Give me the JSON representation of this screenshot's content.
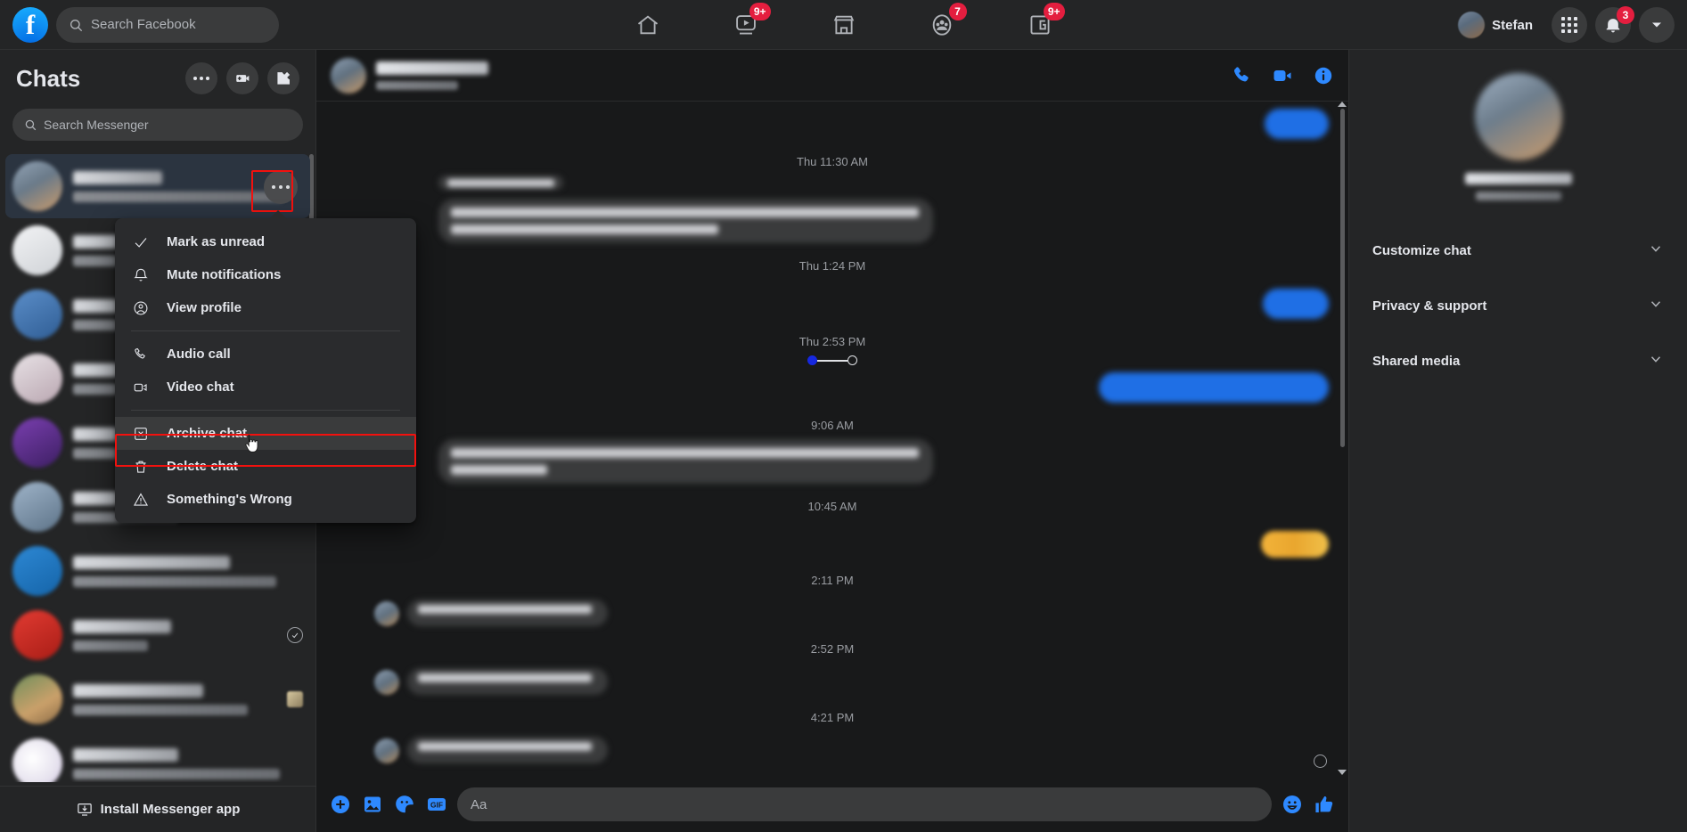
{
  "topbar": {
    "logo_icon": "facebook-logo",
    "search_placeholder": "Search Facebook",
    "search_icon": "search-icon",
    "nav": [
      {
        "name": "home",
        "icon": "home-icon",
        "badge": ""
      },
      {
        "name": "video",
        "icon": "video-icon",
        "badge": "9+"
      },
      {
        "name": "marketplace",
        "icon": "marketplace-icon",
        "badge": ""
      },
      {
        "name": "groups",
        "icon": "groups-icon",
        "badge": "7"
      },
      {
        "name": "gaming",
        "icon": "gaming-icon",
        "badge": "9+"
      }
    ],
    "user_name": "Stefan",
    "menu_icon": "grid-menu-icon",
    "notifications_icon": "bell-icon",
    "notifications_badge": "3",
    "account_icon": "chevron-down-icon"
  },
  "sidebar": {
    "title": "Chats",
    "options_icon": "ellipsis-icon",
    "video_room_icon": "video-plus-icon",
    "new_message_icon": "compose-icon",
    "search_placeholder": "Search Messenger",
    "search_icon": "search-icon",
    "install_label": "Install Messenger app",
    "install_icon": "install-icon",
    "rows": [
      {
        "selected": true,
        "name_w": 100,
        "sub_w": 235,
        "av": "g1",
        "right": "menu"
      },
      {
        "selected": false,
        "name_w": 78,
        "sub_w": 120,
        "av": "g2",
        "right": ""
      },
      {
        "selected": false,
        "name_w": 70,
        "sub_w": 110,
        "av": "g3",
        "right": ""
      },
      {
        "selected": false,
        "name_w": 84,
        "sub_w": 96,
        "av": "g4",
        "right": ""
      },
      {
        "selected": false,
        "name_w": 66,
        "sub_w": 128,
        "av": "g5",
        "right": ""
      },
      {
        "selected": false,
        "name_w": 72,
        "sub_w": 118,
        "av": "g6",
        "right": ""
      },
      {
        "selected": false,
        "name_w": 176,
        "sub_w": 228,
        "av": "g7",
        "right": ""
      },
      {
        "selected": false,
        "name_w": 110,
        "sub_w": 84,
        "av": "g8",
        "right": "tick"
      },
      {
        "selected": false,
        "name_w": 146,
        "sub_w": 196,
        "av": "g9",
        "right": "thumb"
      },
      {
        "selected": false,
        "name_w": 118,
        "sub_w": 232,
        "av": "g10",
        "right": ""
      }
    ]
  },
  "context_menu": {
    "highlighted_item": "Archive chat",
    "items": [
      {
        "label": "Mark as unread",
        "icon": "check-icon",
        "sep_after": false
      },
      {
        "label": "Mute notifications",
        "icon": "bell-icon",
        "sep_after": false
      },
      {
        "label": "View profile",
        "icon": "person-icon",
        "sep_after": true
      },
      {
        "label": "Audio call",
        "icon": "phone-icon",
        "sep_after": false
      },
      {
        "label": "Video chat",
        "icon": "video-icon",
        "sep_after": true
      },
      {
        "label": "Archive chat",
        "icon": "archive-icon",
        "sep_after": false
      },
      {
        "label": "Delete chat",
        "icon": "trash-icon",
        "sep_after": false
      },
      {
        "label": "Something's Wrong",
        "icon": "warning-icon",
        "sep_after": false
      }
    ]
  },
  "conversation": {
    "audio_call_icon": "phone-icon",
    "video_call_icon": "video-icon",
    "info_icon": "info-icon",
    "timestamps": [
      "Thu 11:30 AM",
      "Thu 1:24 PM",
      "Thu 2:53 PM",
      "9:06 AM",
      "10:45 AM",
      "2:11 PM",
      "2:52 PM",
      "4:21 PM"
    ],
    "composer": {
      "placeholder": "Aa",
      "plus_icon": "plus-circle-icon",
      "image_icon": "image-icon",
      "sticker_icon": "sticker-icon",
      "gif_icon": "gif-icon",
      "gif_label": "GIF",
      "emoji_icon": "emoji-icon",
      "like_icon": "thumbs-up-icon"
    }
  },
  "right_panel": {
    "sections": [
      {
        "label": "Customize chat",
        "icon": "chevron-down-icon"
      },
      {
        "label": "Privacy & support",
        "icon": "chevron-down-icon"
      },
      {
        "label": "Shared media",
        "icon": "chevron-down-icon"
      }
    ]
  }
}
